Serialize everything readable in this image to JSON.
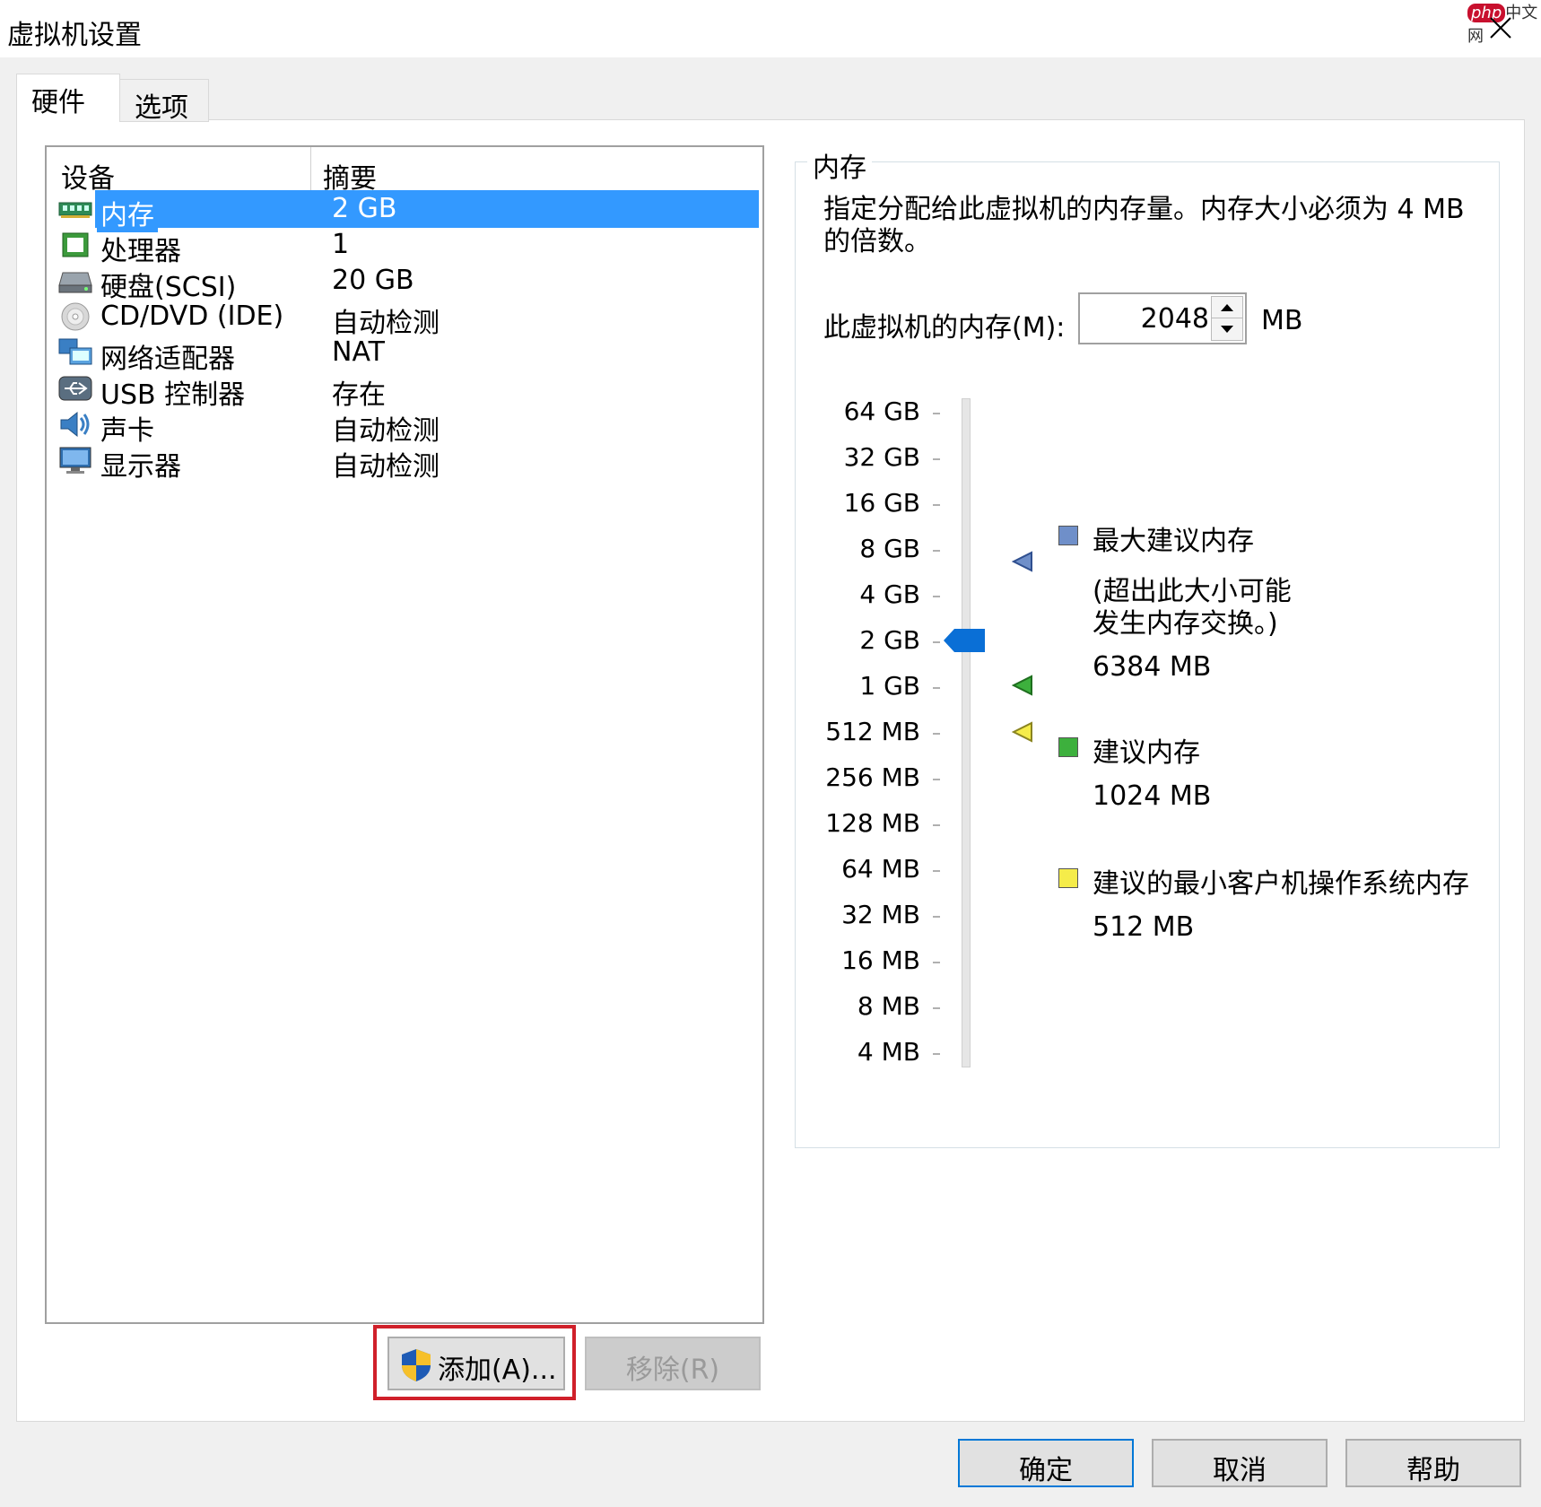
{
  "window": {
    "title": "虚拟机设置"
  },
  "watermark": {
    "brand": "php",
    "site": "中文网"
  },
  "tabs": [
    {
      "label": "硬件",
      "active": true
    },
    {
      "label": "选项",
      "active": false
    }
  ],
  "device_list": {
    "col_device": "设备",
    "col_summary": "摘要",
    "rows": [
      {
        "name": "内存",
        "summary": "2 GB",
        "icon": "memory-icon",
        "selected": true
      },
      {
        "name": "处理器",
        "summary": "1",
        "icon": "processor-icon"
      },
      {
        "name": "硬盘(SCSI)",
        "summary": "20 GB",
        "icon": "hard-disk-icon"
      },
      {
        "name": "CD/DVD (IDE)",
        "summary": "自动检测",
        "icon": "cd-dvd-icon"
      },
      {
        "name": "网络适配器",
        "summary": "NAT",
        "icon": "network-adapter-icon"
      },
      {
        "name": "USB 控制器",
        "summary": "存在",
        "icon": "usb-icon"
      },
      {
        "name": "声卡",
        "summary": "自动检测",
        "icon": "sound-card-icon"
      },
      {
        "name": "显示器",
        "summary": "自动检测",
        "icon": "display-icon"
      }
    ]
  },
  "buttons": {
    "add": "添加(A)...",
    "remove": "移除(R)",
    "ok": "确定",
    "cancel": "取消",
    "help": "帮助"
  },
  "memory": {
    "group_title": "内存",
    "description": "指定分配给此虚拟机的内存量。内存大小必须为 4 MB 的倍数。",
    "label": "此虚拟机的内存(M):",
    "value": "2048",
    "unit": "MB",
    "scale_labels": [
      "64 GB",
      "32 GB",
      "16 GB",
      "8 GB",
      "4 GB",
      "2 GB",
      "1 GB",
      "512 MB",
      "256 MB",
      "128 MB",
      "64 MB",
      "32 MB",
      "16 MB",
      "8 MB",
      "4 MB"
    ],
    "current": "2 GB",
    "legend": {
      "max_title": "最大建议内存",
      "max_note_1": "(超出此大小可能",
      "max_note_2": "发生内存交换。)",
      "max_value": "6384 MB",
      "rec_title": "建议内存",
      "rec_value": "1024 MB",
      "min_title": "建议的最小客户机操作系统内存",
      "min_value": "512 MB"
    },
    "colors": {
      "max": "#6f8fc9",
      "recommended": "#3db03d",
      "minimum": "#f5ec4a",
      "thumb": "#0a6fd6",
      "selection": "#3399ff"
    }
  }
}
